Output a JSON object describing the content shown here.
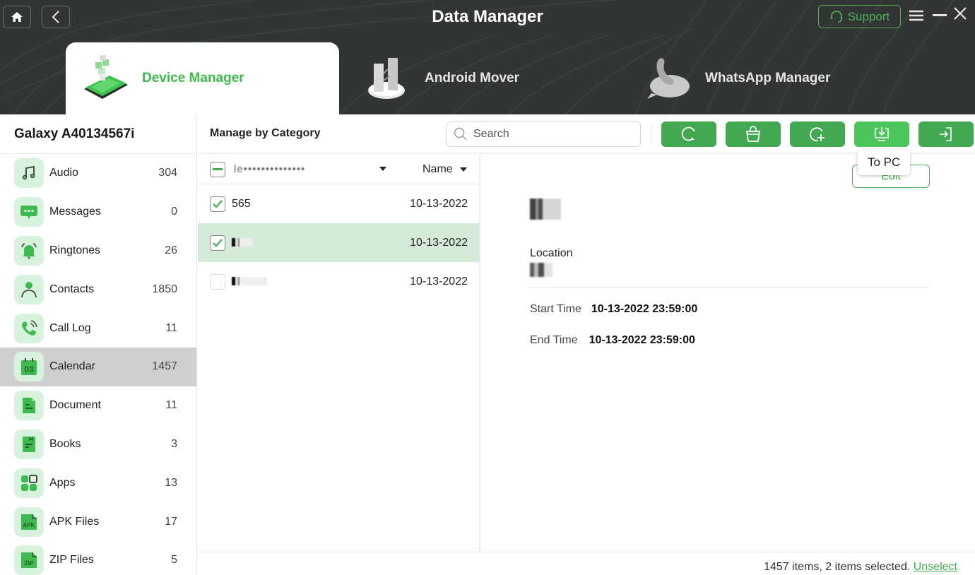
{
  "app": {
    "title": "Data Manager",
    "support_label": "Support"
  },
  "tabs": [
    {
      "label": "Device Manager",
      "active": true,
      "icon": "device-manager-icon"
    },
    {
      "label": "Android Mover",
      "active": false,
      "icon": "android-mover-icon"
    },
    {
      "label": "WhatsApp Manager",
      "active": false,
      "icon": "whatsapp-manager-icon"
    }
  ],
  "sidebar": {
    "device_name": "Galaxy A40134567i",
    "items": [
      {
        "label": "Audio",
        "count": "304",
        "icon": "music-note-icon"
      },
      {
        "label": "Messages",
        "count": "0",
        "icon": "message-bubble-icon"
      },
      {
        "label": "Ringtones",
        "count": "26",
        "icon": "bell-icon"
      },
      {
        "label": "Contacts",
        "count": "1850",
        "icon": "person-icon"
      },
      {
        "label": "Call Log",
        "count": "11",
        "icon": "phone-call-icon"
      },
      {
        "label": "Calendar",
        "count": "1457",
        "icon": "calendar-icon",
        "selected": true,
        "icon_text": "03"
      },
      {
        "label": "Document",
        "count": "11",
        "icon": "document-icon"
      },
      {
        "label": "Books",
        "count": "3",
        "icon": "book-icon"
      },
      {
        "label": "Apps",
        "count": "13",
        "icon": "apps-grid-icon"
      },
      {
        "label": "APK Files",
        "count": "17",
        "icon": "apk-file-icon",
        "icon_text": "APK"
      },
      {
        "label": "ZIP Files",
        "count": "5",
        "icon": "zip-file-icon",
        "icon_text": "ZIP"
      }
    ]
  },
  "toolbar": {
    "title": "Manage by Category",
    "search_placeholder": "Search",
    "buttons": [
      {
        "name": "refresh",
        "icon": "refresh-icon"
      },
      {
        "name": "delete",
        "icon": "trash-icon"
      },
      {
        "name": "add",
        "icon": "add-circle-icon"
      },
      {
        "name": "to-pc",
        "icon": "download-to-pc-icon",
        "tooltip": "To PC"
      },
      {
        "name": "to-device",
        "icon": "import-to-device-icon"
      }
    ],
    "tooltip": "To PC"
  },
  "list": {
    "account_filter": "le••••••••••••••",
    "sort_label": "Name",
    "rows": [
      {
        "name": "565",
        "date": "10-13-2022",
        "checked": true,
        "selected": false
      },
      {
        "name": "",
        "date": "10-13-2022",
        "checked": true,
        "selected": true
      },
      {
        "name": "",
        "date": "10-13-2022",
        "checked": false,
        "selected": false
      }
    ]
  },
  "detail": {
    "edit_label": "Edit",
    "location_label": "Location",
    "start_time_label": "Start Time",
    "start_time": "10-13-2022 23:59:00",
    "end_time_label": "End Time",
    "end_time": "10-13-2022 23:59:00"
  },
  "footer": {
    "status": "1457 items, 2 items selected.",
    "unselect_label": "Unselect"
  },
  "colors": {
    "accent": "#43a852",
    "accent_bright": "#3fba4d",
    "header_bg": "#333534",
    "row_selected": "#d4ebd9",
    "sidebar_selected": "#cfcfcf"
  }
}
